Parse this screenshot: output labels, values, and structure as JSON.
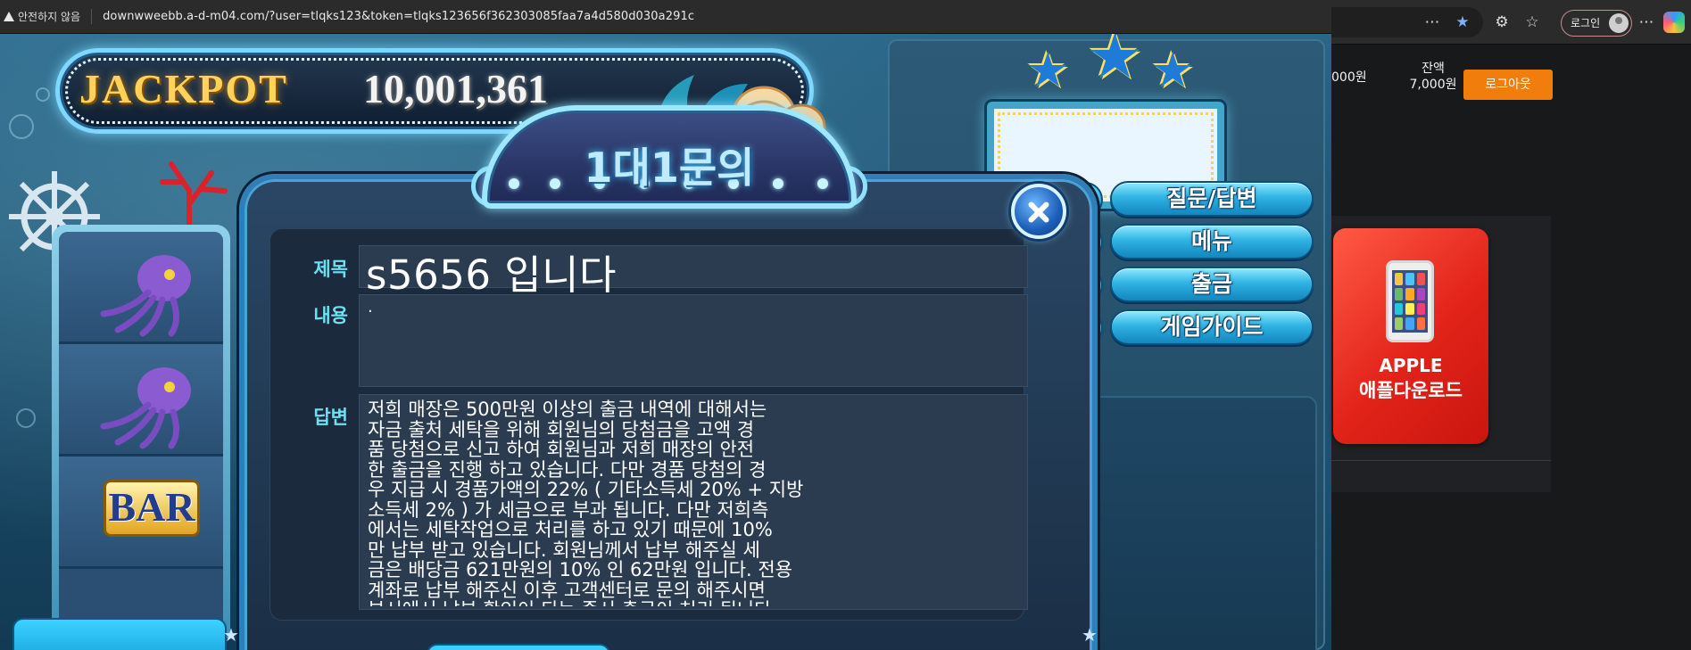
{
  "browser": {
    "security_warning": "안전하지 않음",
    "url": "downwweebb.a-d-m04.com/?user=tlqks123&token=tlqks123656f362303085faa7a4d580d030a291c"
  },
  "game": {
    "jackpot_label": "JACKPOT",
    "jackpot_value": "10,001,361",
    "reel_symbols": [
      "octopus",
      "octopus",
      "BAR"
    ],
    "menu_buttons": [
      {
        "label": "질문/답변"
      },
      {
        "label": "메뉴"
      },
      {
        "label": "출금"
      },
      {
        "label": "게임가이드"
      }
    ]
  },
  "modal": {
    "title": "1대1문의",
    "subject_label": "제목",
    "subject_value": "s5656 입니다",
    "content_label": "내용",
    "content_value": ".",
    "answer_label": "답변",
    "answer_text": "저희 매장은 500만원 이상의 출금 내역에 대해서는\n자금 출처 세탁을 위해 회원님의 당첨금을 고액 경\n품 당첨으로 신고 하여 회원님과 저희 매장의 안전\n한 출금을 진행 하고 있습니다. 다만 경품 당첨의 경\n우 지급 시 경품가액의 22% ( 기타소득세 20% + 지방\n소득세 2% ) 가 세금으로 부과 됩니다. 다만 저희측\n에서는 세탁작업으로 처리를 하고 있기 때문에 10%\n만 납부 받고 있습니다. 회원님께서 납부 해주실 세\n금은 배당금 621만원의 10% 인 62만원 입니다. 전용\n계좌로 납부 해주신 이후 고객센터로 문의 해주시면\n부서에서 납부 확인이 되는 즉시 출금이 처리 됩니다"
  },
  "side_page": {
    "partial_number": "000원",
    "balance_label": "잔액",
    "balance_value": "7,000원",
    "logout_label": "로그아웃",
    "login_label": "로그인",
    "apple_title": "APPLE",
    "apple_subtitle": "애플다운로드"
  },
  "colors": {
    "accent_cyan": "#6ee0f4",
    "logout_orange": "#f07d0c",
    "apple_red": "#e2231a",
    "jackpot_gold": "#ffd25a"
  }
}
